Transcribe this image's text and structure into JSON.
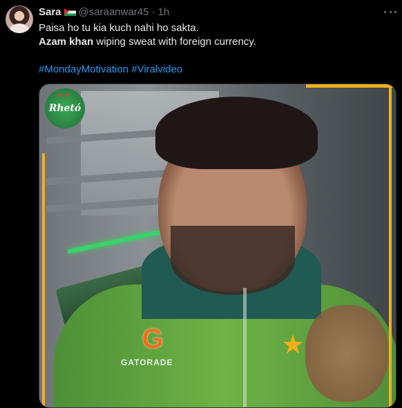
{
  "tweet": {
    "display_name": "Sara",
    "handle": "@saraanwar45",
    "separator": "·",
    "time": "1h",
    "line1": "Paisa ho tu kia kuch nahi ho sakta.",
    "line2_bold": "Azam khan",
    "line2_rest": " wiping sweat with foreign currency.",
    "hashtags": [
      "#MondayMotivation",
      "#Viralvideo"
    ],
    "hashtag_color": "#1d9bf0"
  },
  "media": {
    "logo_text": "Rhetó",
    "sponsor_text": "GATORADE",
    "sponsor_icon": "gatorade-g-icon",
    "accent_color": "#f2b01b"
  },
  "icons": {
    "more": "more-dots-icon",
    "flag": "palestine-flag-icon",
    "avatar": "user-avatar"
  }
}
